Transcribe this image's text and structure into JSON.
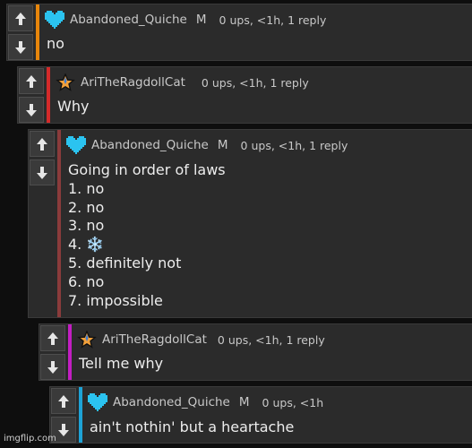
{
  "colors": {
    "background": "#0e0e0e",
    "card": "#2b2b2b",
    "bar_orange": "#e8860b",
    "bar_red": "#d42a2a",
    "bar_maroon": "#8a3b3b",
    "bar_magenta": "#c21ec2",
    "bar_cyan": "#1ea3d6",
    "heart": "#2bc3f0"
  },
  "icons": {
    "upvote": "arrow-up-icon",
    "downvote": "arrow-down-icon",
    "avatar_heart": "pixel-heart-icon",
    "avatar_star": "star-icon"
  },
  "comments": [
    {
      "username": "Abandoned_Quiche",
      "flag": "M",
      "meta": "0 ups, <1h, 1 reply",
      "lines": [
        "no"
      ]
    },
    {
      "username": "AriTheRagdollCat",
      "flag": "",
      "meta": "0 ups, <1h, 1 reply",
      "lines": [
        "Why"
      ]
    },
    {
      "username": "Abandoned_Quiche",
      "flag": "M",
      "meta": "0 ups, <1h, 1 reply",
      "lines": [
        "Going in order of laws",
        "1. no",
        "2. no",
        "3. no",
        "4. ❄️",
        "5. definitely not",
        "6. no",
        "7. impossible"
      ]
    },
    {
      "username": "AriTheRagdollCat",
      "flag": "",
      "meta": "0 ups, <1h, 1 reply",
      "lines": [
        "Tell me why"
      ]
    },
    {
      "username": "Abandoned_Quiche",
      "flag": "M",
      "meta": "0 ups, <1h",
      "lines": [
        "ain't nothin' but a heartache"
      ]
    }
  ],
  "watermark": "imgflip.com"
}
